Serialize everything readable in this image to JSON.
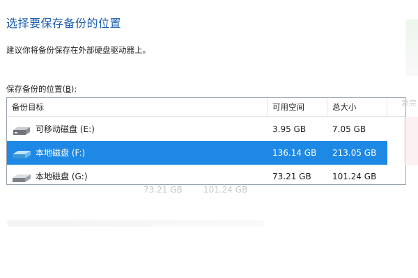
{
  "top_fragment": "",
  "title": "选择要保存备份的位置",
  "description": "建议你将备份保存在外部硬盘驱动器上。",
  "list": {
    "label_prefix": "保存备份的位置(",
    "label_accel": "B",
    "label_suffix": "):",
    "columns": {
      "name": "备份目标",
      "free": "可用空间",
      "total": "总大小"
    },
    "rows": [
      {
        "name": "可移动磁盘 (E:)",
        "free": "3.95 GB",
        "total": "7.05 GB",
        "selected": false,
        "icon": "removable-drive-icon"
      },
      {
        "name": "本地磁盘 (F:)",
        "free": "136.14 GB",
        "total": "213.05 GB",
        "selected": true,
        "icon": "local-disk-icon"
      },
      {
        "name": "本地磁盘 (G:)",
        "free": "73.21 GB",
        "total": "101.24 GB",
        "selected": false,
        "icon": "local-disk-icon"
      }
    ]
  },
  "ghost": {
    "free": "73.21 GB",
    "total": "101.24 GB"
  },
  "right_edge_text": "复完",
  "colors": {
    "title": "#1a5db0",
    "selection": "#1e88e5"
  }
}
